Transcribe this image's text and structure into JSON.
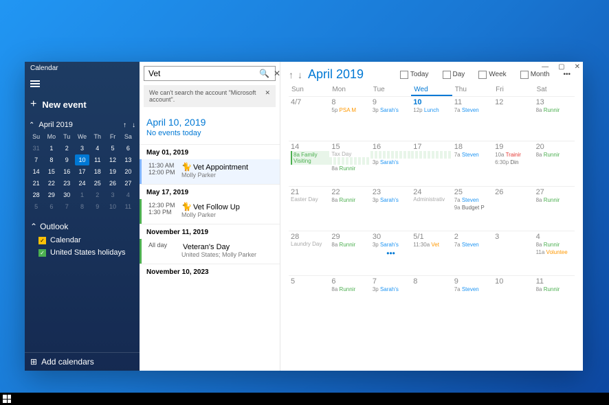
{
  "window": {
    "title": "Calendar"
  },
  "sidebar": {
    "new_event": "New event",
    "mini_cal": {
      "label": "April 2019",
      "day_headers": [
        "Su",
        "Mo",
        "Tu",
        "We",
        "Th",
        "Fr",
        "Sa"
      ],
      "weeks": [
        [
          {
            "n": "31",
            "dim": true
          },
          {
            "n": "1"
          },
          {
            "n": "2"
          },
          {
            "n": "3"
          },
          {
            "n": "4"
          },
          {
            "n": "5"
          },
          {
            "n": "6"
          }
        ],
        [
          {
            "n": "7"
          },
          {
            "n": "8"
          },
          {
            "n": "9"
          },
          {
            "n": "10",
            "today": true
          },
          {
            "n": "11"
          },
          {
            "n": "12"
          },
          {
            "n": "13"
          }
        ],
        [
          {
            "n": "14"
          },
          {
            "n": "15"
          },
          {
            "n": "16"
          },
          {
            "n": "17"
          },
          {
            "n": "18"
          },
          {
            "n": "19"
          },
          {
            "n": "20"
          }
        ],
        [
          {
            "n": "21"
          },
          {
            "n": "22"
          },
          {
            "n": "23"
          },
          {
            "n": "24"
          },
          {
            "n": "25"
          },
          {
            "n": "26"
          },
          {
            "n": "27"
          }
        ],
        [
          {
            "n": "28"
          },
          {
            "n": "29"
          },
          {
            "n": "30"
          },
          {
            "n": "1",
            "dim": true
          },
          {
            "n": "2",
            "dim": true
          },
          {
            "n": "3",
            "dim": true
          },
          {
            "n": "4",
            "dim": true
          }
        ],
        [
          {
            "n": "5",
            "dim": true
          },
          {
            "n": "6",
            "dim": true
          },
          {
            "n": "7",
            "dim": true
          },
          {
            "n": "8",
            "dim": true
          },
          {
            "n": "9",
            "dim": true
          },
          {
            "n": "10",
            "dim": true
          },
          {
            "n": "11",
            "dim": true
          }
        ]
      ]
    },
    "account_name": "Outlook",
    "calendars": [
      {
        "label": "Calendar",
        "color": "yellow"
      },
      {
        "label": "United States holidays",
        "color": "green"
      }
    ],
    "add_calendars": "Add calendars"
  },
  "search": {
    "query": "Vet",
    "error": "We can't search the account \"Microsoft account\".",
    "selected_date": "April 10, 2019",
    "no_events": "No events today",
    "results": [
      {
        "date": "May 01, 2019",
        "time1": "11:30 AM",
        "time2": "12:00 PM",
        "icon": "🐈",
        "title": "Vet Appointment",
        "location": "Molly Parker",
        "color": "blue"
      },
      {
        "date": "May 17, 2019",
        "time1": "12:30 PM",
        "time2": "1:30 PM",
        "icon": "🐈",
        "title": "Vet Follow Up",
        "location": "Molly Parker",
        "color": "green"
      },
      {
        "date": "November 11, 2019",
        "time1": "All day",
        "time2": "",
        "icon": "",
        "title": "Veteran's Day",
        "location": "United States; Molly Parker",
        "color": "green"
      },
      {
        "date": "November 10, 2023",
        "time1": "",
        "time2": "",
        "icon": "",
        "title": "",
        "location": "",
        "color": ""
      }
    ]
  },
  "main": {
    "title": "April 2019",
    "views": {
      "today": "Today",
      "day": "Day",
      "week": "Week",
      "month": "Month"
    },
    "day_headers": [
      "Sun",
      "Mon",
      "Tue",
      "Wed",
      "Thu",
      "Fri",
      "Sat"
    ],
    "weeks": [
      [
        {
          "n": "4/7"
        },
        {
          "n": "8",
          "ev": [
            {
              "t": "5p",
              "txt": "PSA M",
              "c": "orange"
            }
          ]
        },
        {
          "n": "9",
          "ev": [
            {
              "t": "3p",
              "txt": "Sarah's",
              "c": "blue"
            }
          ]
        },
        {
          "n": "10",
          "today": true,
          "ev": [
            {
              "t": "12p",
              "txt": "Lunch",
              "c": "blue"
            }
          ]
        },
        {
          "n": "11",
          "ev": [
            {
              "t": "7a",
              "txt": "Steven",
              "c": "blue"
            }
          ]
        },
        {
          "n": "12"
        },
        {
          "n": "13",
          "ev": [
            {
              "t": "8a",
              "txt": "Runnir",
              "c": "green"
            }
          ]
        }
      ],
      [
        {
          "n": "14",
          "span": {
            "txt": "8a Family Visiting",
            "start": true
          }
        },
        {
          "n": "15",
          "span": {
            "cont": true
          },
          "sub": "Tax Day",
          "ev": [
            {
              "t": "8a",
              "txt": "Runnir",
              "c": "green"
            }
          ]
        },
        {
          "n": "16",
          "span": {
            "cont": true
          },
          "ev": [
            {
              "t": "3p",
              "txt": "Sarah's",
              "c": "blue"
            }
          ]
        },
        {
          "n": "17",
          "span": {
            "cont": true,
            "end": true
          }
        },
        {
          "n": "18",
          "ev": [
            {
              "t": "7a",
              "txt": "Steven",
              "c": "blue"
            }
          ]
        },
        {
          "n": "19",
          "ev": [
            {
              "t": "10a",
              "txt": "Trainir",
              "c": "red"
            },
            {
              "t": "6:30p",
              "txt": "Din"
            }
          ]
        },
        {
          "n": "20",
          "ev": [
            {
              "t": "8a",
              "txt": "Runnir",
              "c": "green"
            }
          ]
        }
      ],
      [
        {
          "n": "21",
          "sub": "Easter Day"
        },
        {
          "n": "22",
          "ev": [
            {
              "t": "8a",
              "txt": "Runnir",
              "c": "green"
            }
          ]
        },
        {
          "n": "23",
          "ev": [
            {
              "t": "3p",
              "txt": "Sarah's",
              "c": "blue"
            }
          ]
        },
        {
          "n": "24",
          "sub": "Administrativ"
        },
        {
          "n": "25",
          "ev": [
            {
              "t": "7a",
              "txt": "Steven",
              "c": "blue"
            },
            {
              "t": "9a",
              "txt": "Budget P"
            }
          ]
        },
        {
          "n": "26"
        },
        {
          "n": "27",
          "ev": [
            {
              "t": "8a",
              "txt": "Runnir",
              "c": "green"
            }
          ]
        }
      ],
      [
        {
          "n": "28",
          "sub": "Laundry Day"
        },
        {
          "n": "29",
          "ev": [
            {
              "t": "8a",
              "txt": "Runnir",
              "c": "green"
            }
          ]
        },
        {
          "n": "30",
          "ev": [
            {
              "t": "3p",
              "txt": "Sarah's",
              "c": "blue"
            }
          ],
          "more": true
        },
        {
          "n": "5/1",
          "ev": [
            {
              "t": "11:30a",
              "txt": "Vet",
              "c": "orange"
            }
          ]
        },
        {
          "n": "2",
          "ev": [
            {
              "t": "7a",
              "txt": "Steven",
              "c": "blue"
            }
          ]
        },
        {
          "n": "3"
        },
        {
          "n": "4",
          "ev": [
            {
              "t": "8a",
              "txt": "Runnir",
              "c": "green"
            },
            {
              "t": "11a",
              "txt": "Voluntee",
              "c": "orange"
            }
          ]
        }
      ],
      [
        {
          "n": "5"
        },
        {
          "n": "6",
          "ev": [
            {
              "t": "8a",
              "txt": "Runnir",
              "c": "green"
            }
          ]
        },
        {
          "n": "7",
          "ev": [
            {
              "t": "3p",
              "txt": "Sarah's",
              "c": "blue"
            }
          ]
        },
        {
          "n": "8"
        },
        {
          "n": "9",
          "ev": [
            {
              "t": "7a",
              "txt": "Steven",
              "c": "blue"
            }
          ]
        },
        {
          "n": "10"
        },
        {
          "n": "11",
          "ev": [
            {
              "t": "8a",
              "txt": "Runnir",
              "c": "green"
            }
          ]
        }
      ]
    ]
  }
}
